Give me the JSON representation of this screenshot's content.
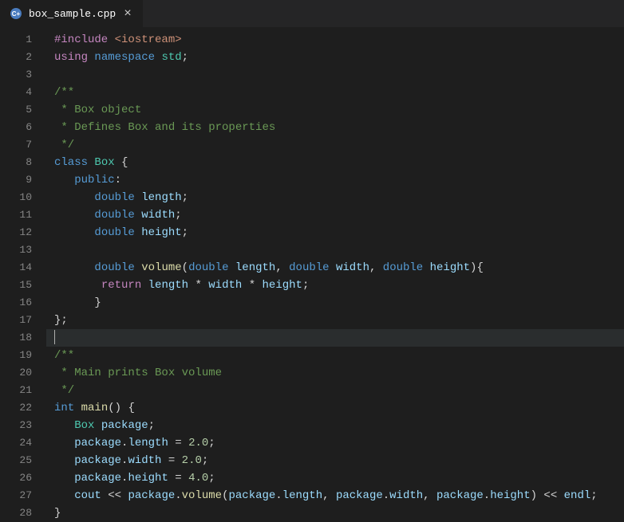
{
  "tab": {
    "filename": "box_sample.cpp",
    "close": "×"
  },
  "lines": {
    "count": 28
  },
  "code": {
    "l1": {
      "include": "#include",
      "header": "<iostream>"
    },
    "l2": {
      "using": "using",
      "namespace": "namespace",
      "std": "std",
      "semi": ";"
    },
    "l4": {
      "open": "/**"
    },
    "l5": {
      "txt": " * Box object"
    },
    "l6": {
      "txt": " * Defines Box and its properties"
    },
    "l7": {
      "close": " */"
    },
    "l8": {
      "class": "class",
      "name": "Box",
      "brace": " {"
    },
    "l9": {
      "public": "public",
      "colon": ":"
    },
    "l10": {
      "type": "double",
      "name": "length",
      "semi": ";"
    },
    "l11": {
      "type": "double",
      "name": "width",
      "semi": ";"
    },
    "l12": {
      "type": "double",
      "name": "height",
      "semi": ";"
    },
    "l14": {
      "type": "double",
      "func": "volume",
      "p1t": "double",
      "p1n": "length",
      "p2t": "double",
      "p2n": "width",
      "p3t": "double",
      "p3n": "height",
      "open": "(",
      "c1": ", ",
      "c2": ", ",
      "close": "){"
    },
    "l15": {
      "return": "return",
      "a": "length",
      "b": "width",
      "c": "height",
      "m1": " * ",
      "m2": " * ",
      "semi": ";"
    },
    "l16": {
      "brace": "}"
    },
    "l17": {
      "brace": "};"
    },
    "l19": {
      "open": "/**"
    },
    "l20": {
      "txt": " * Main prints Box volume"
    },
    "l21": {
      "close": " */"
    },
    "l22": {
      "type": "int",
      "func": "main",
      "parens": "()",
      "brace": " {"
    },
    "l23": {
      "type": "Box",
      "name": "package",
      "semi": ";"
    },
    "l24": {
      "obj": "package",
      "dot": ".",
      "prop": "length",
      "eq": " = ",
      "val": "2.0",
      "semi": ";"
    },
    "l25": {
      "obj": "package",
      "dot": ".",
      "prop": "width",
      "eq": " = ",
      "val": "2.0",
      "semi": ";"
    },
    "l26": {
      "obj": "package",
      "dot": ".",
      "prop": "height",
      "eq": " = ",
      "val": "4.0",
      "semi": ";"
    },
    "l27": {
      "cout": "cout",
      "op1": " << ",
      "obj": "package",
      "dot": ".",
      "func": "volume",
      "open": "(",
      "a1o": "package",
      "a1d": ".",
      "a1p": "length",
      "c1": ", ",
      "a2o": "package",
      "a2d": ".",
      "a2p": "width",
      "c2": ", ",
      "a3o": "package",
      "a3d": ".",
      "a3p": "height",
      "close": ")",
      "op2": " << ",
      "endl": "endl",
      "semi": ";"
    },
    "l28": {
      "brace": "}"
    }
  }
}
